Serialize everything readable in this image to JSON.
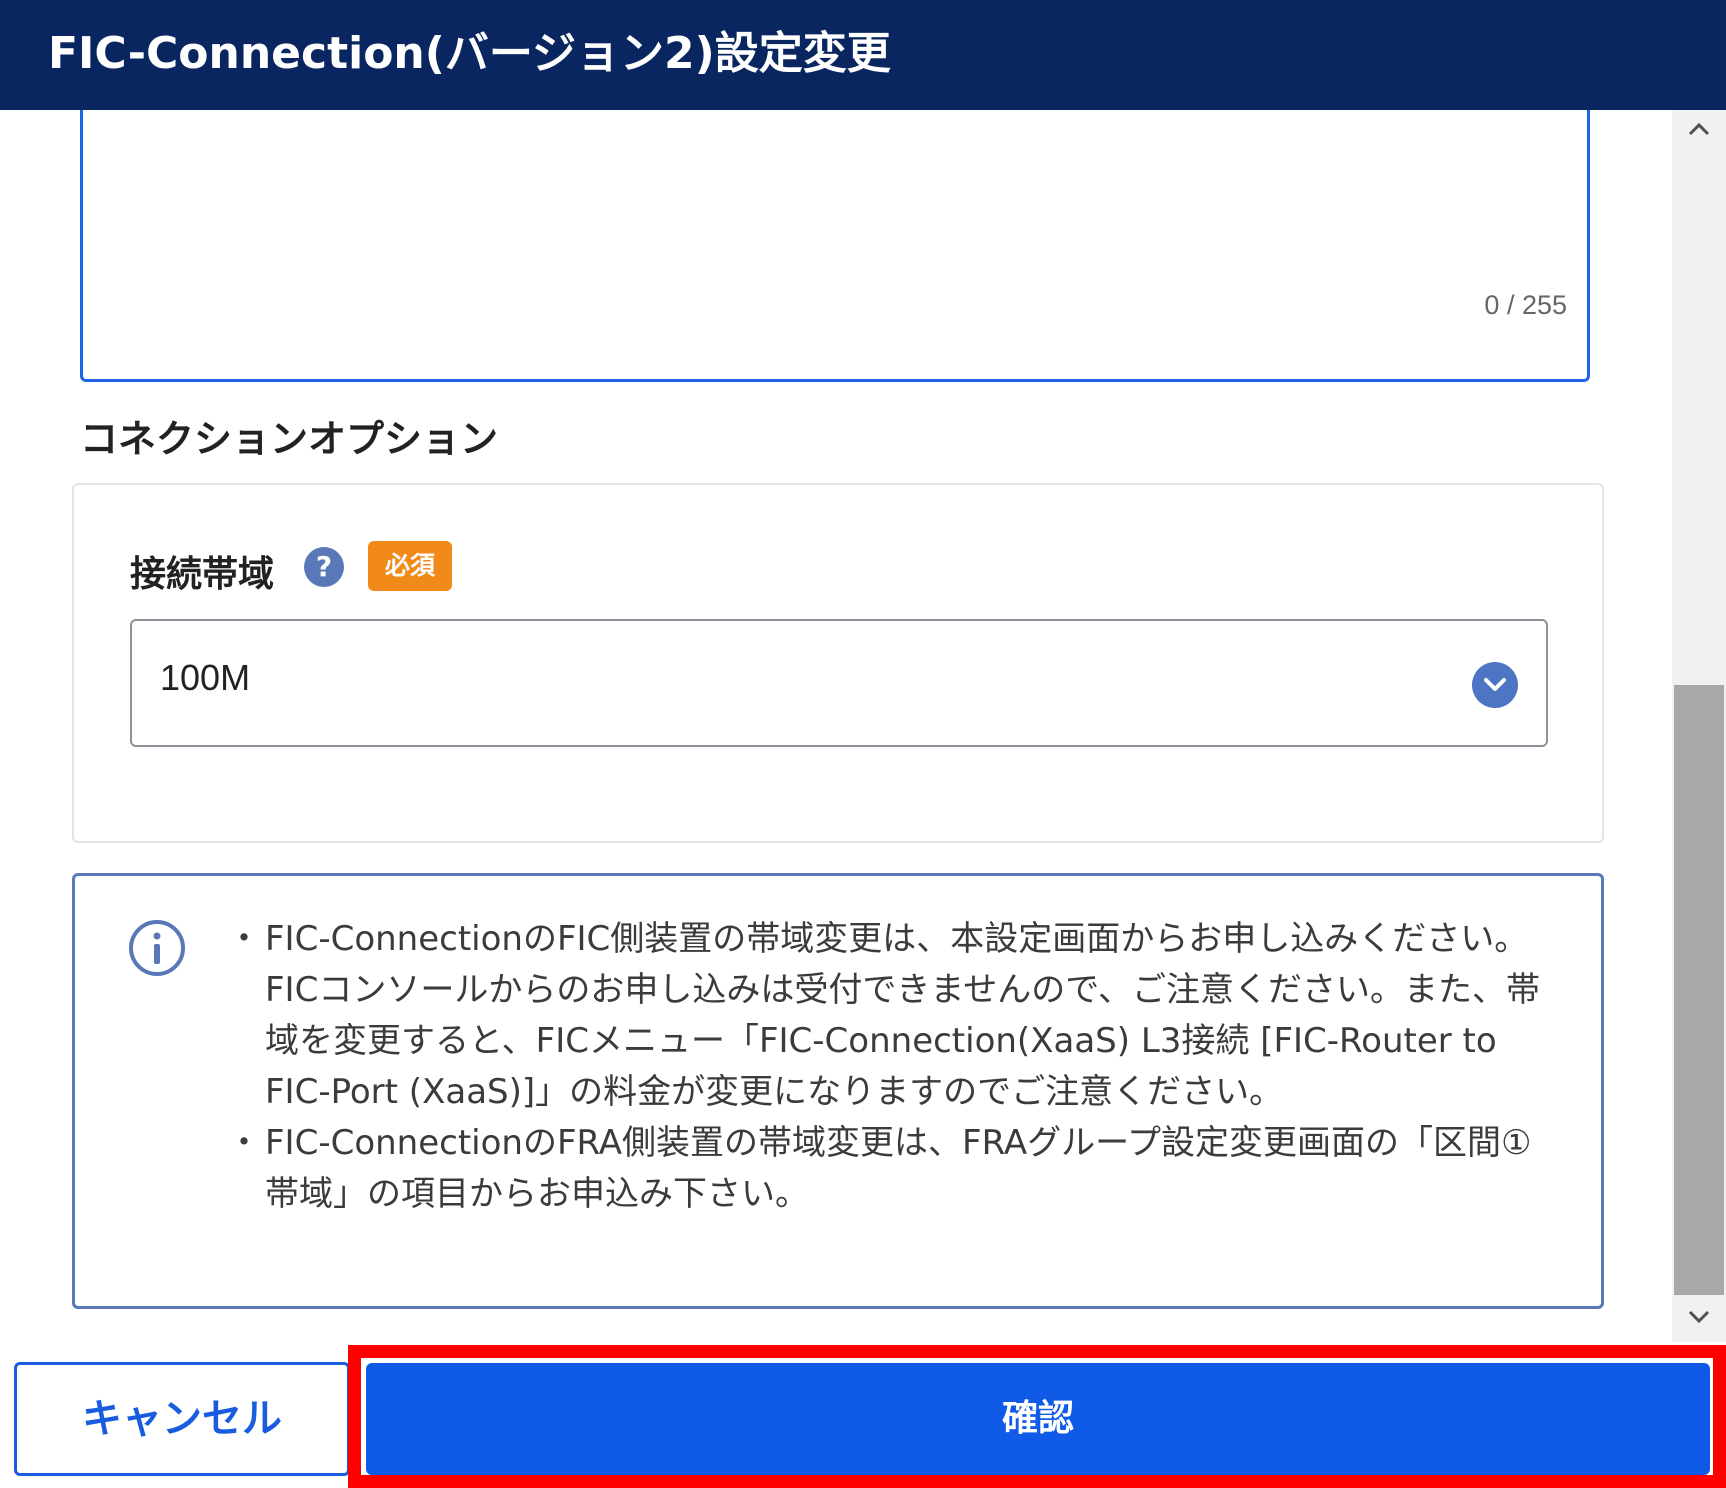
{
  "dialog": {
    "title": "FIC-Connection(バージョン2)設定変更"
  },
  "description_field": {
    "counter": "0 / 255"
  },
  "connection_options": {
    "section_title": "コネクションオプション",
    "bandwidth": {
      "label": "接続帯域",
      "help_icon": "?",
      "required_badge": "必須",
      "selected_value": "100M"
    }
  },
  "notice": {
    "items": [
      "FIC-ConnectionのFIC側装置の帯域変更は、本設定画面からお申し込みください。FICコンソールからのお申し込みは受付できませんので、ご注意ください。また、帯域を変更すると、FICメニュー「FIC-Connection(XaaS) L3接続 [FIC-Router to FIC-Port (XaaS)]」の料金が変更になりますのでご注意ください。",
      "FIC-ConnectionのFRA側装置の帯域変更は、FRAグループ設定変更画面の「区間①帯域」の項目からお申込み下さい。"
    ]
  },
  "footer": {
    "cancel_label": "キャンセル",
    "confirm_label": "確認"
  },
  "colors": {
    "header_bg": "#0a2660",
    "primary": "#0f5ae6",
    "required_badge": "#f28a1a",
    "highlight": "#ff0000"
  },
  "icons": [
    "help-icon",
    "chevron-down-icon",
    "info-icon",
    "scroll-up-arrow-icon",
    "scroll-down-arrow-icon"
  ]
}
